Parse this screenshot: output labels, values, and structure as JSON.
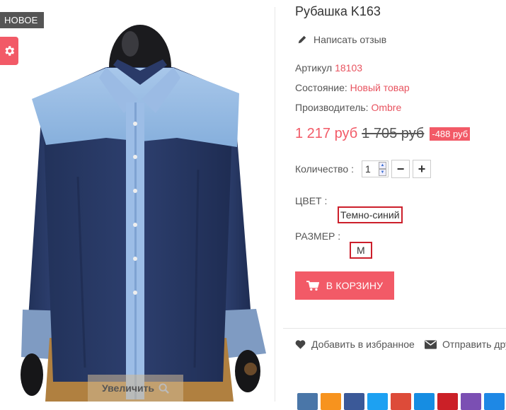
{
  "badge": {
    "label": "НОВОЕ"
  },
  "image": {
    "zoom_label": "Увеличить"
  },
  "product": {
    "title": "Рубашка K163",
    "review_link": "Написать отзыв",
    "sku_label": "Артикул",
    "sku": "18103",
    "condition_label": "Состояние:",
    "condition": "Новый товар",
    "manufacturer_label": "Производитель:",
    "manufacturer": "Ombre"
  },
  "price": {
    "current": "1 217 руб",
    "old": "1 705 руб",
    "discount": "-488 руб"
  },
  "quantity": {
    "label": "Количество :",
    "value": "1",
    "minus": "−",
    "plus": "+"
  },
  "options": {
    "color_label": "ЦВЕТ :",
    "color_value": "Темно-синий",
    "size_label": "РАЗМЕР :",
    "size_value": "M"
  },
  "cart": {
    "button_label": "В КОРЗИНУ"
  },
  "actions": {
    "wishlist": "Добавить в избранное",
    "send": "Отправить дру"
  },
  "colors": {
    "accent": "#f25a67",
    "link": "#e8535f",
    "option_border": "#cc1f2b",
    "badge_bg": "#555555",
    "share": [
      "#4a76a8",
      "#f7931e",
      "#3b5998",
      "#1da1f2",
      "#dd4b39",
      "#168de2",
      "#cb2027",
      "#7b4fb3",
      "#1e88e5"
    ]
  }
}
